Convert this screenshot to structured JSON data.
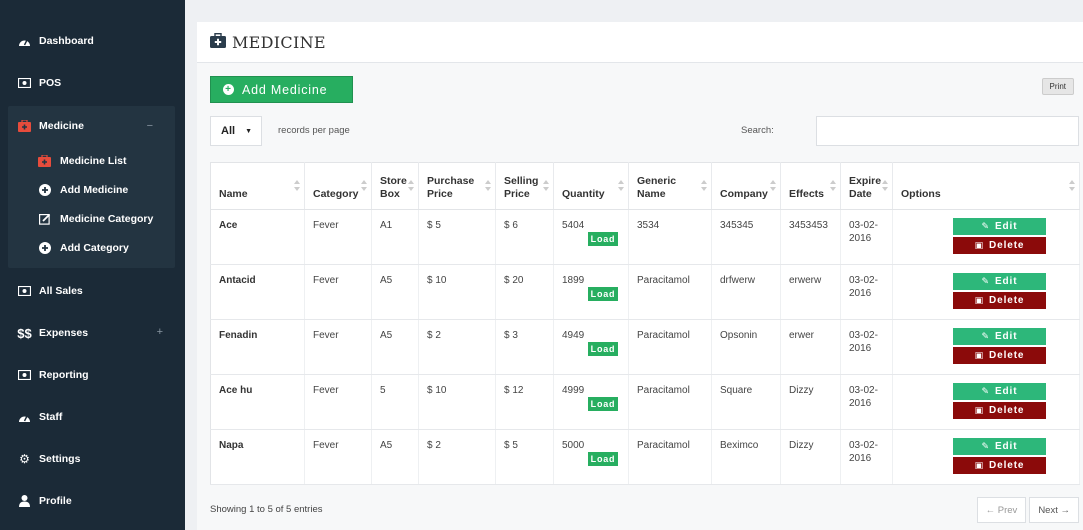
{
  "sidebar": {
    "items": [
      {
        "label": "Dashboard",
        "icon": "dashboard-icon"
      },
      {
        "label": "POS",
        "icon": "pos-icon"
      },
      {
        "label": "Medicine",
        "icon": "medkit-icon",
        "toggle": "−"
      },
      {
        "label": "All Sales",
        "icon": "sales-icon"
      },
      {
        "label": "Expenses",
        "icon": "money-icon",
        "toggle": "+"
      },
      {
        "label": "Reporting",
        "icon": "report-icon"
      },
      {
        "label": "Staff",
        "icon": "staff-icon"
      },
      {
        "label": "Settings",
        "icon": "gears-icon"
      },
      {
        "label": "Profile",
        "icon": "user-icon"
      }
    ],
    "medicine_sub": [
      {
        "label": "Medicine List",
        "icon": "medkit-icon"
      },
      {
        "label": "Add Medicine",
        "icon": "plus-circle-icon"
      },
      {
        "label": "Medicine Category",
        "icon": "edit-icon"
      },
      {
        "label": "Add Category",
        "icon": "plus-circle-icon"
      }
    ]
  },
  "header": {
    "title": "MEDICINE",
    "icon": "medkit-icon"
  },
  "toolbar": {
    "add_label": "Add Medicine",
    "print_label": "Print"
  },
  "controls": {
    "length_value": "All",
    "length_label": "records per page",
    "search_label": "Search:",
    "search_value": ""
  },
  "table": {
    "columns": [
      "Name",
      "Category",
      "Store Box",
      "Purchase Price",
      "Selling Price",
      "Quantity",
      "Generic Name",
      "Company",
      "Effects",
      "Expire Date",
      "Options"
    ],
    "load_label": "Load",
    "edit_label": "Edit",
    "delete_label": "Delete",
    "rows": [
      {
        "name": "Ace",
        "category": "Fever",
        "box": "A1",
        "purchase": "$ 5",
        "selling": "$ 6",
        "quantity": "5404",
        "generic": "3534",
        "company": "345345",
        "effects": "3453453",
        "expire": "03-02-2016"
      },
      {
        "name": "Antacid",
        "category": "Fever",
        "box": "A5",
        "purchase": "$ 10",
        "selling": "$ 20",
        "quantity": "1899",
        "generic": "Paracitamol",
        "company": "drfwerw",
        "effects": "erwerw",
        "expire": "03-02-2016"
      },
      {
        "name": "Fenadin",
        "category": "Fever",
        "box": "A5",
        "purchase": "$ 2",
        "selling": "$ 3",
        "quantity": "4949",
        "generic": "Paracitamol",
        "company": "Opsonin",
        "effects": "erwer",
        "expire": "03-02-2016"
      },
      {
        "name": "Ace hu",
        "category": "Fever",
        "box": "5",
        "purchase": "$ 10",
        "selling": "$ 12",
        "quantity": "4999",
        "generic": "Paracitamol",
        "company": "Square",
        "effects": "Dizzy",
        "expire": "03-02-2016"
      },
      {
        "name": "Napa",
        "category": "Fever",
        "box": "A5",
        "purchase": "$ 2",
        "selling": "$ 5",
        "quantity": "5000",
        "generic": "Paracitamol",
        "company": "Beximco",
        "effects": "Dizzy",
        "expire": "03-02-2016"
      }
    ]
  },
  "footer": {
    "info": "Showing 1 to 5 of 5 entries",
    "prev_label": "← Prev",
    "next_label": "Next →"
  },
  "colors": {
    "sidebar_bg": "#1b2a37",
    "accent_green": "#27ae60",
    "edit_green": "#2db77a",
    "delete_red": "#8b0a0a",
    "medicine_red": "#e74c3c"
  }
}
